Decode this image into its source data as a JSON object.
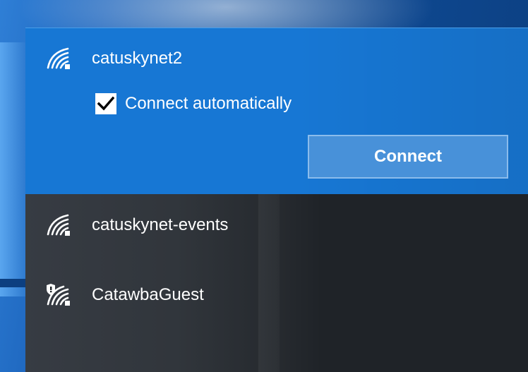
{
  "networks": [
    {
      "name": "catuskynet2",
      "icon": "wifi-signal-icon",
      "selected": true,
      "connect_automatically_label": "Connect automatically",
      "connect_automatically_checked": true,
      "connect_label": "Connect"
    },
    {
      "name": "catuskynet-events",
      "icon": "wifi-signal-icon",
      "selected": false
    },
    {
      "name": "CatawbaGuest",
      "icon": "wifi-unsecured-shield-icon",
      "selected": false
    }
  ],
  "colors": {
    "selected_bg": "#1777d4",
    "panel_bg": "#1f2328",
    "button_bg": "#4891d9",
    "button_border": "#8bbcec",
    "text": "#ffffff"
  }
}
